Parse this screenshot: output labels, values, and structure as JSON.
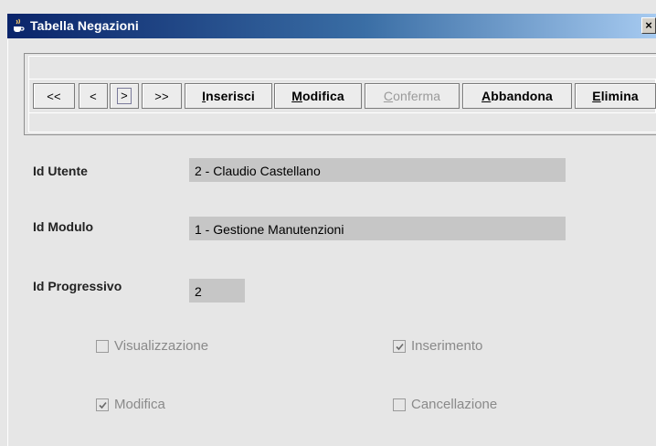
{
  "window": {
    "title": "Tabella Negazioni",
    "close_glyph": "×"
  },
  "toolbar": {
    "first": "<<",
    "prev": "<",
    "next": ">",
    "last": ">>",
    "insert": "Inserisci",
    "modify": "Modifica",
    "confirm": "Conferma",
    "abandon": "Abbandona",
    "delete": "Elimina"
  },
  "form": {
    "id_utente_label": "Id Utente",
    "id_utente_value": "2 - Claudio Castellano",
    "id_modulo_label": "Id Modulo",
    "id_modulo_value": "1 - Gestione Manutenzioni",
    "id_progressivo_label": "Id Progressivo",
    "id_progressivo_value": "2"
  },
  "permissions": [
    {
      "label": "Visualizzazione",
      "checked": false
    },
    {
      "label": "Inserimento",
      "checked": true
    },
    {
      "label": "Modifica",
      "checked": true
    },
    {
      "label": "Cancellazione",
      "checked": false
    }
  ],
  "icons": {
    "app": "java-coffee-cup-icon",
    "close": "close-icon",
    "check": "check-icon"
  },
  "colors": {
    "titlebar_start": "#0a246a",
    "titlebar_end": "#a6caf0",
    "field_bg": "#c6c6c6",
    "disabled_text": "#8a8a8a"
  }
}
